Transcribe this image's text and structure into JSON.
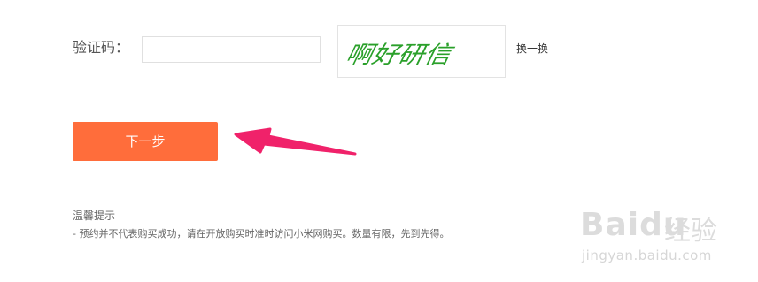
{
  "form": {
    "captcha_label": "验证码：",
    "captcha_value": "",
    "captcha_placeholder": "",
    "captcha_image_text": "啊好研信",
    "refresh_label": "换一换"
  },
  "actions": {
    "next_label": "下一步"
  },
  "tips": {
    "title": "温馨提示",
    "text": "- 预约并不代表购买成功，请在开放购买时准时访问小米网购买。数量有限，先到先得。"
  },
  "watermark": {
    "logo": "Baidu",
    "brand": "经验",
    "url": "jingyan.baidu.com"
  },
  "colors": {
    "primary_button": "#ff6d3b",
    "annotation_arrow": "#f0226a",
    "captcha_text": "#2aa02a"
  }
}
